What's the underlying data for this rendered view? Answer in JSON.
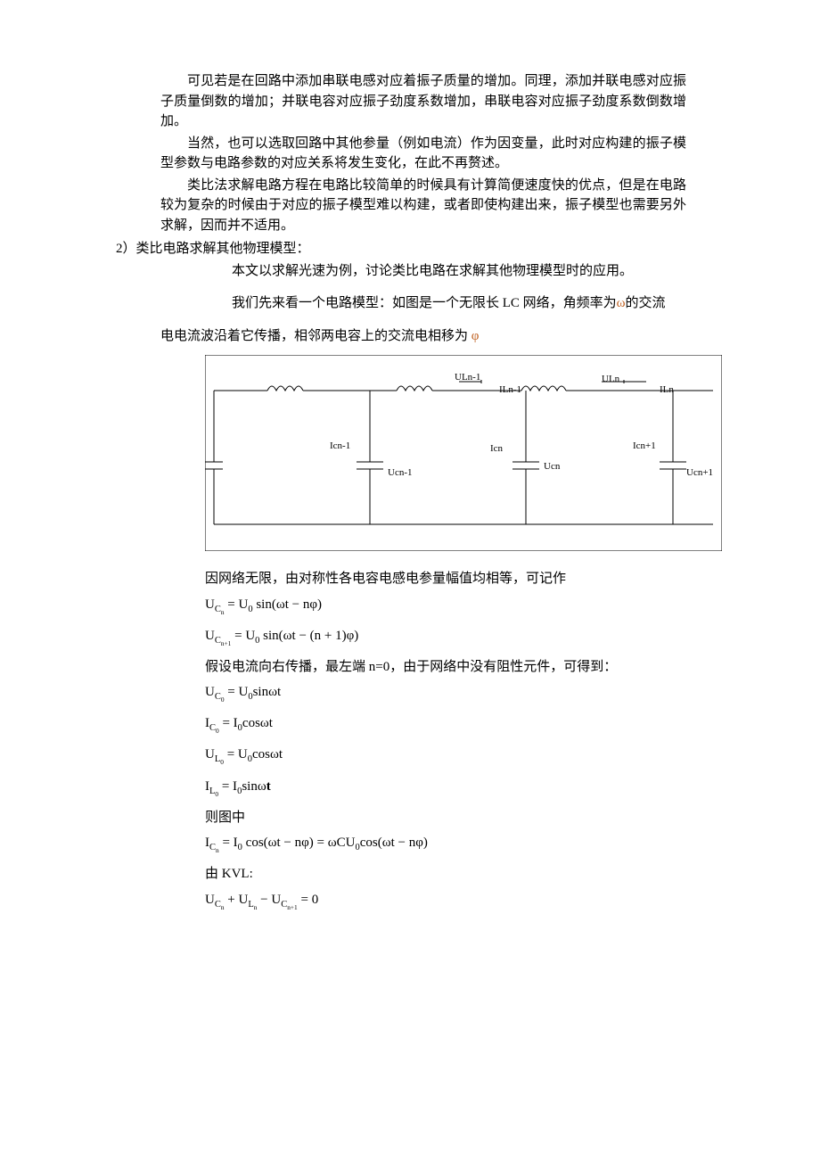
{
  "paras": {
    "p1": "可见若是在回路中添加串联电感对应着振子质量的增加。同理，添加并联电感对应振子质量倒数的增加；并联电容对应振子劲度系数增加，串联电容对应振子劲度系数倒数增加。",
    "p2": "当然，也可以选取回路中其他参量（例如电流）作为因变量，此时对应构建的振子模型参数与电路参数的对应关系将发生变化，在此不再赘述。",
    "p3": "类比法求解电路方程在电路比较简单的时候具有计算简便速度快的优点，但是在电路较为复杂的时候由于对应的振子模型难以构建，或者即使构建出来，振子模型也需要另外求解，因而并不适用。",
    "h1": "2）类比电路求解其他物理模型：",
    "p4": "本文以求解光速为例，讨论类比电路在求解其他物理模型时的应用。",
    "p5a": "我们先来看一个电路模型：如图是一个无限长 LC 网络，角频率为",
    "p5b": "的交流",
    "p6a": "电电流波沿着它传播，相邻两电容上的交流电相移为 ",
    "p7": "因网络无限，由对称性各电容电感电参量幅值均相等，可记作",
    "p8": "假设电流向右传播，最左端 n=0，由于网络中没有阻性元件，可得到：",
    "p9": "则图中",
    "p10": "由 KVL:"
  },
  "eqs": {
    "e1": "U_{C_n} = U_0 sin(ωt − nφ)",
    "e2": "U_{C_{n+1}} = U_0 sin(ωt − (n + 1)φ)",
    "e3": "U_{C_0} = U_0 sinωt",
    "e4": "I_{C_0} = I_0 cosωt",
    "e5": "U_{L_0} = U_0 cosωt",
    "e6": "I_{L_0} = I_0 sinωt",
    "e7": "I_{C_n} = I_0 cos(ωt − nφ) = ωCU_0 cos(ωt − nφ)",
    "e8": "U_{C_n} + U_{L_n} − U_{C_{n+1}} = 0"
  },
  "omega": "ω",
  "phi": "φ",
  "circuit": {
    "ULn_1": "ULn-1",
    "ILn_1": "ILn-1",
    "ULn": "ULn",
    "ILn": "ILn",
    "Icn_1": "Icn-1",
    "Icn": "Icn",
    "Icn1": "Icn+1",
    "Ucn_1": "Ucn-1",
    "Ucn": "Ucn",
    "Ucn1": "Ucn+1"
  }
}
